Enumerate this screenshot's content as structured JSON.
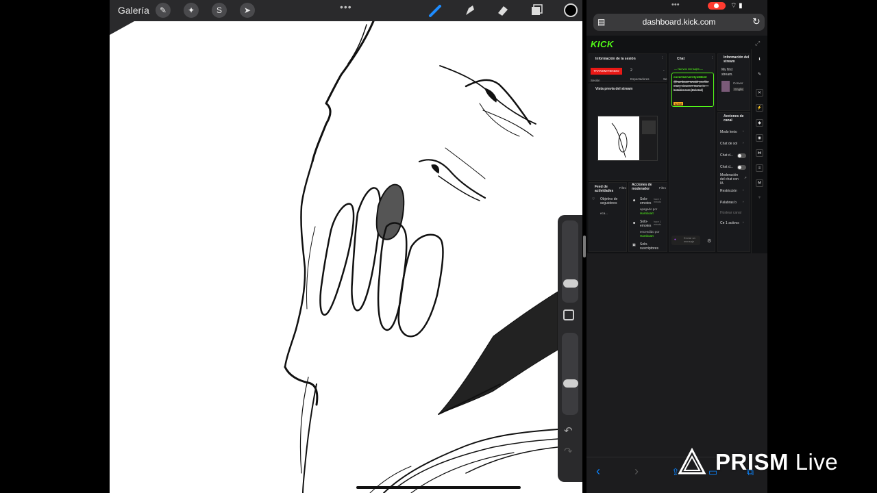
{
  "procreate": {
    "gallery_label": "Galería",
    "toolbar_dots": "•••",
    "current_color": "#000000"
  },
  "safari": {
    "url": "dashboard.kick.com",
    "top_dots": "•••",
    "status_icons": "⌔ ▮"
  },
  "kick": {
    "logo": "KICK",
    "session_panel_title": "Información de la sesión",
    "live_badge": "TRANSMITIENDO",
    "viewers_count": "2",
    "viewers_label": "Espectadores",
    "session_label": "Sesión",
    "dash": "-",
    "se_label": "Se",
    "preview_panel_title": "Vista previa del stream",
    "chat_panel_title": "Chat",
    "new_messages": "— Nuevos mensajes —",
    "chat_message_user": "covertservervtyo63ez2",
    "chat_message_text": "@hamboart Would you like many viewers? Come in — botsider.com [Deleted]",
    "chat_message_badge": "Ai bot",
    "chat_input_placeholder": "Enviar un mensaje",
    "stream_info_title": "Información del stream",
    "stream_title": "My first stream.",
    "stream_category": "Conver",
    "stream_language": "Englis",
    "channel_actions_title": "Acciones de canal",
    "channel_actions": [
      {
        "label": "Modo lento",
        "control": "chevron"
      },
      {
        "label": "Chat de sol",
        "control": "chevron"
      },
      {
        "label": "Chat d...",
        "control": "toggle"
      },
      {
        "label": "Chat d...",
        "control": "toggle"
      },
      {
        "label": "Moderación del chat con IA",
        "control": "external"
      },
      {
        "label": "Restricción",
        "control": "chevron"
      },
      {
        "label": "Palabras b",
        "control": "chevron"
      },
      {
        "label": "Hostear canal",
        "control": "none"
      },
      {
        "label": "C● 1 activos",
        "control": "chevron"
      }
    ],
    "activity_feed_title": "Feed de actividades",
    "activity_filter": "Filtro",
    "activity_item_title": "Objetivo de seguidores",
    "activity_item_sub": "eca...",
    "mod_actions_title": "Acciones de moderador",
    "mod_filter": "Filtro",
    "mod_items": [
      {
        "title": "Solo-emotes",
        "time": "hace 1 minuto",
        "detail": "apagado por",
        "user": "Hamboart"
      },
      {
        "title": "Solo-emotes",
        "time": "hace 1 minuto",
        "detail": "encendido por",
        "user": "Hamboart"
      },
      {
        "title": "Solo-suscriptores",
        "time": "",
        "detail": "",
        "user": ""
      }
    ]
  },
  "watermark": {
    "brand": "PRISM",
    "suffix": "Live"
  }
}
